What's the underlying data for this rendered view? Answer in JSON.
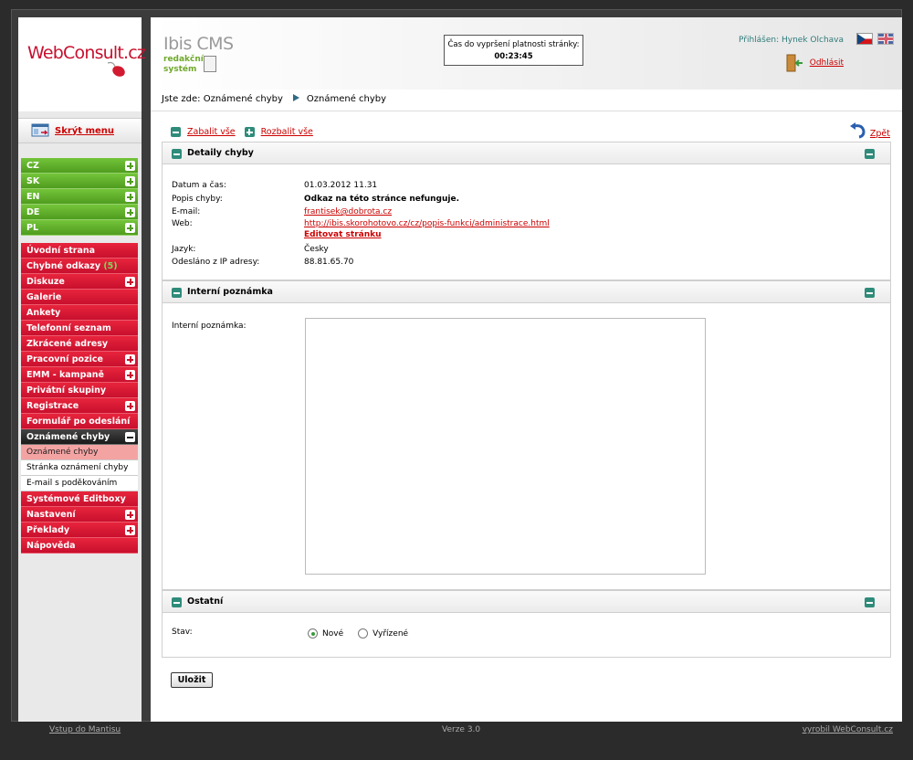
{
  "sidebar": {
    "logo_web": "Web",
    "logo_consult": "Consult.cz",
    "hide_menu": "Skrýt menu",
    "languages": [
      "CZ",
      "SK",
      "EN",
      "DE",
      "PL"
    ],
    "menu": {
      "uvodni": "Úvodní strana",
      "chybne": "Chybné odkazy",
      "chybne_count": "(5)",
      "diskuze": "Diskuze",
      "galerie": "Galerie",
      "ankety": "Ankety",
      "telefon": "Telefonní seznam",
      "zkracene": "Zkrácené adresy",
      "pracovni": "Pracovní pozice",
      "emm": "EMM - kampaně",
      "privatni": "Privátní skupiny",
      "registrace": "Registrace",
      "formular": "Formulář po odeslání",
      "oznamene": "Oznámené chyby",
      "sub_oznamene": "Oznámené chyby",
      "sub_stranka": "Stránka oznámení chyby",
      "sub_email": "E-mail s poděkováním",
      "systemove": "Systémové Editboxy",
      "nastaveni": "Nastavení",
      "preklady": "Překlady",
      "napoveda": "Nápověda"
    }
  },
  "header": {
    "cms_title": "Ibis CMS",
    "cms_sub1": "redakční",
    "cms_sub2": "systém",
    "timer_label": "Čas do vypršení platnosti stránky:",
    "timer_value": "00:23:45",
    "login_text": "Přihlášen: Hynek Olchava",
    "logout": "Odhlásit"
  },
  "breadcrumb": {
    "label": "Jste zde:",
    "item1": "Oznámené chyby",
    "item2": "Oznámené chyby"
  },
  "toolbar": {
    "collapse_all": "Zabalit vše",
    "expand_all": "Rozbalit vše",
    "back": "Zpět"
  },
  "details": {
    "title": "Detaily chyby",
    "date_label": "Datum a čas:",
    "date_value": "01.03.2012 11.31",
    "desc_label": "Popis chyby:",
    "desc_value": "Odkaz na této stránce nefunguje.",
    "email_label": "E-mail:",
    "email_value": "frantisek@dobrota.cz",
    "web_label": "Web:",
    "web_value": "http://ibis.skorohotovo.cz/cz/popis-funkci/administrace.html",
    "edit_link": "Editovat stránku",
    "lang_label": "Jazyk:",
    "lang_value": "Česky",
    "ip_label": "Odesláno z IP adresy:",
    "ip_value": "88.81.65.70"
  },
  "note": {
    "title": "Interní poznámka",
    "label": "Interní poznámka:",
    "value": ""
  },
  "other": {
    "title": "Ostatní",
    "status_label": "Stav:",
    "option_new": "Nové",
    "option_done": "Vyřízené",
    "selected": "Nové"
  },
  "save_label": "Uložit",
  "footer": {
    "mantis": "Vstup do Mantisu",
    "version": "Verze 3.0",
    "made_by": "vyrobil WebConsult.cz"
  },
  "colors": {
    "menu_red": "#c8102e",
    "menu_green": "#4f9c1f",
    "accent_teal": "#2e8b7a",
    "link_red": "#cc0000"
  }
}
